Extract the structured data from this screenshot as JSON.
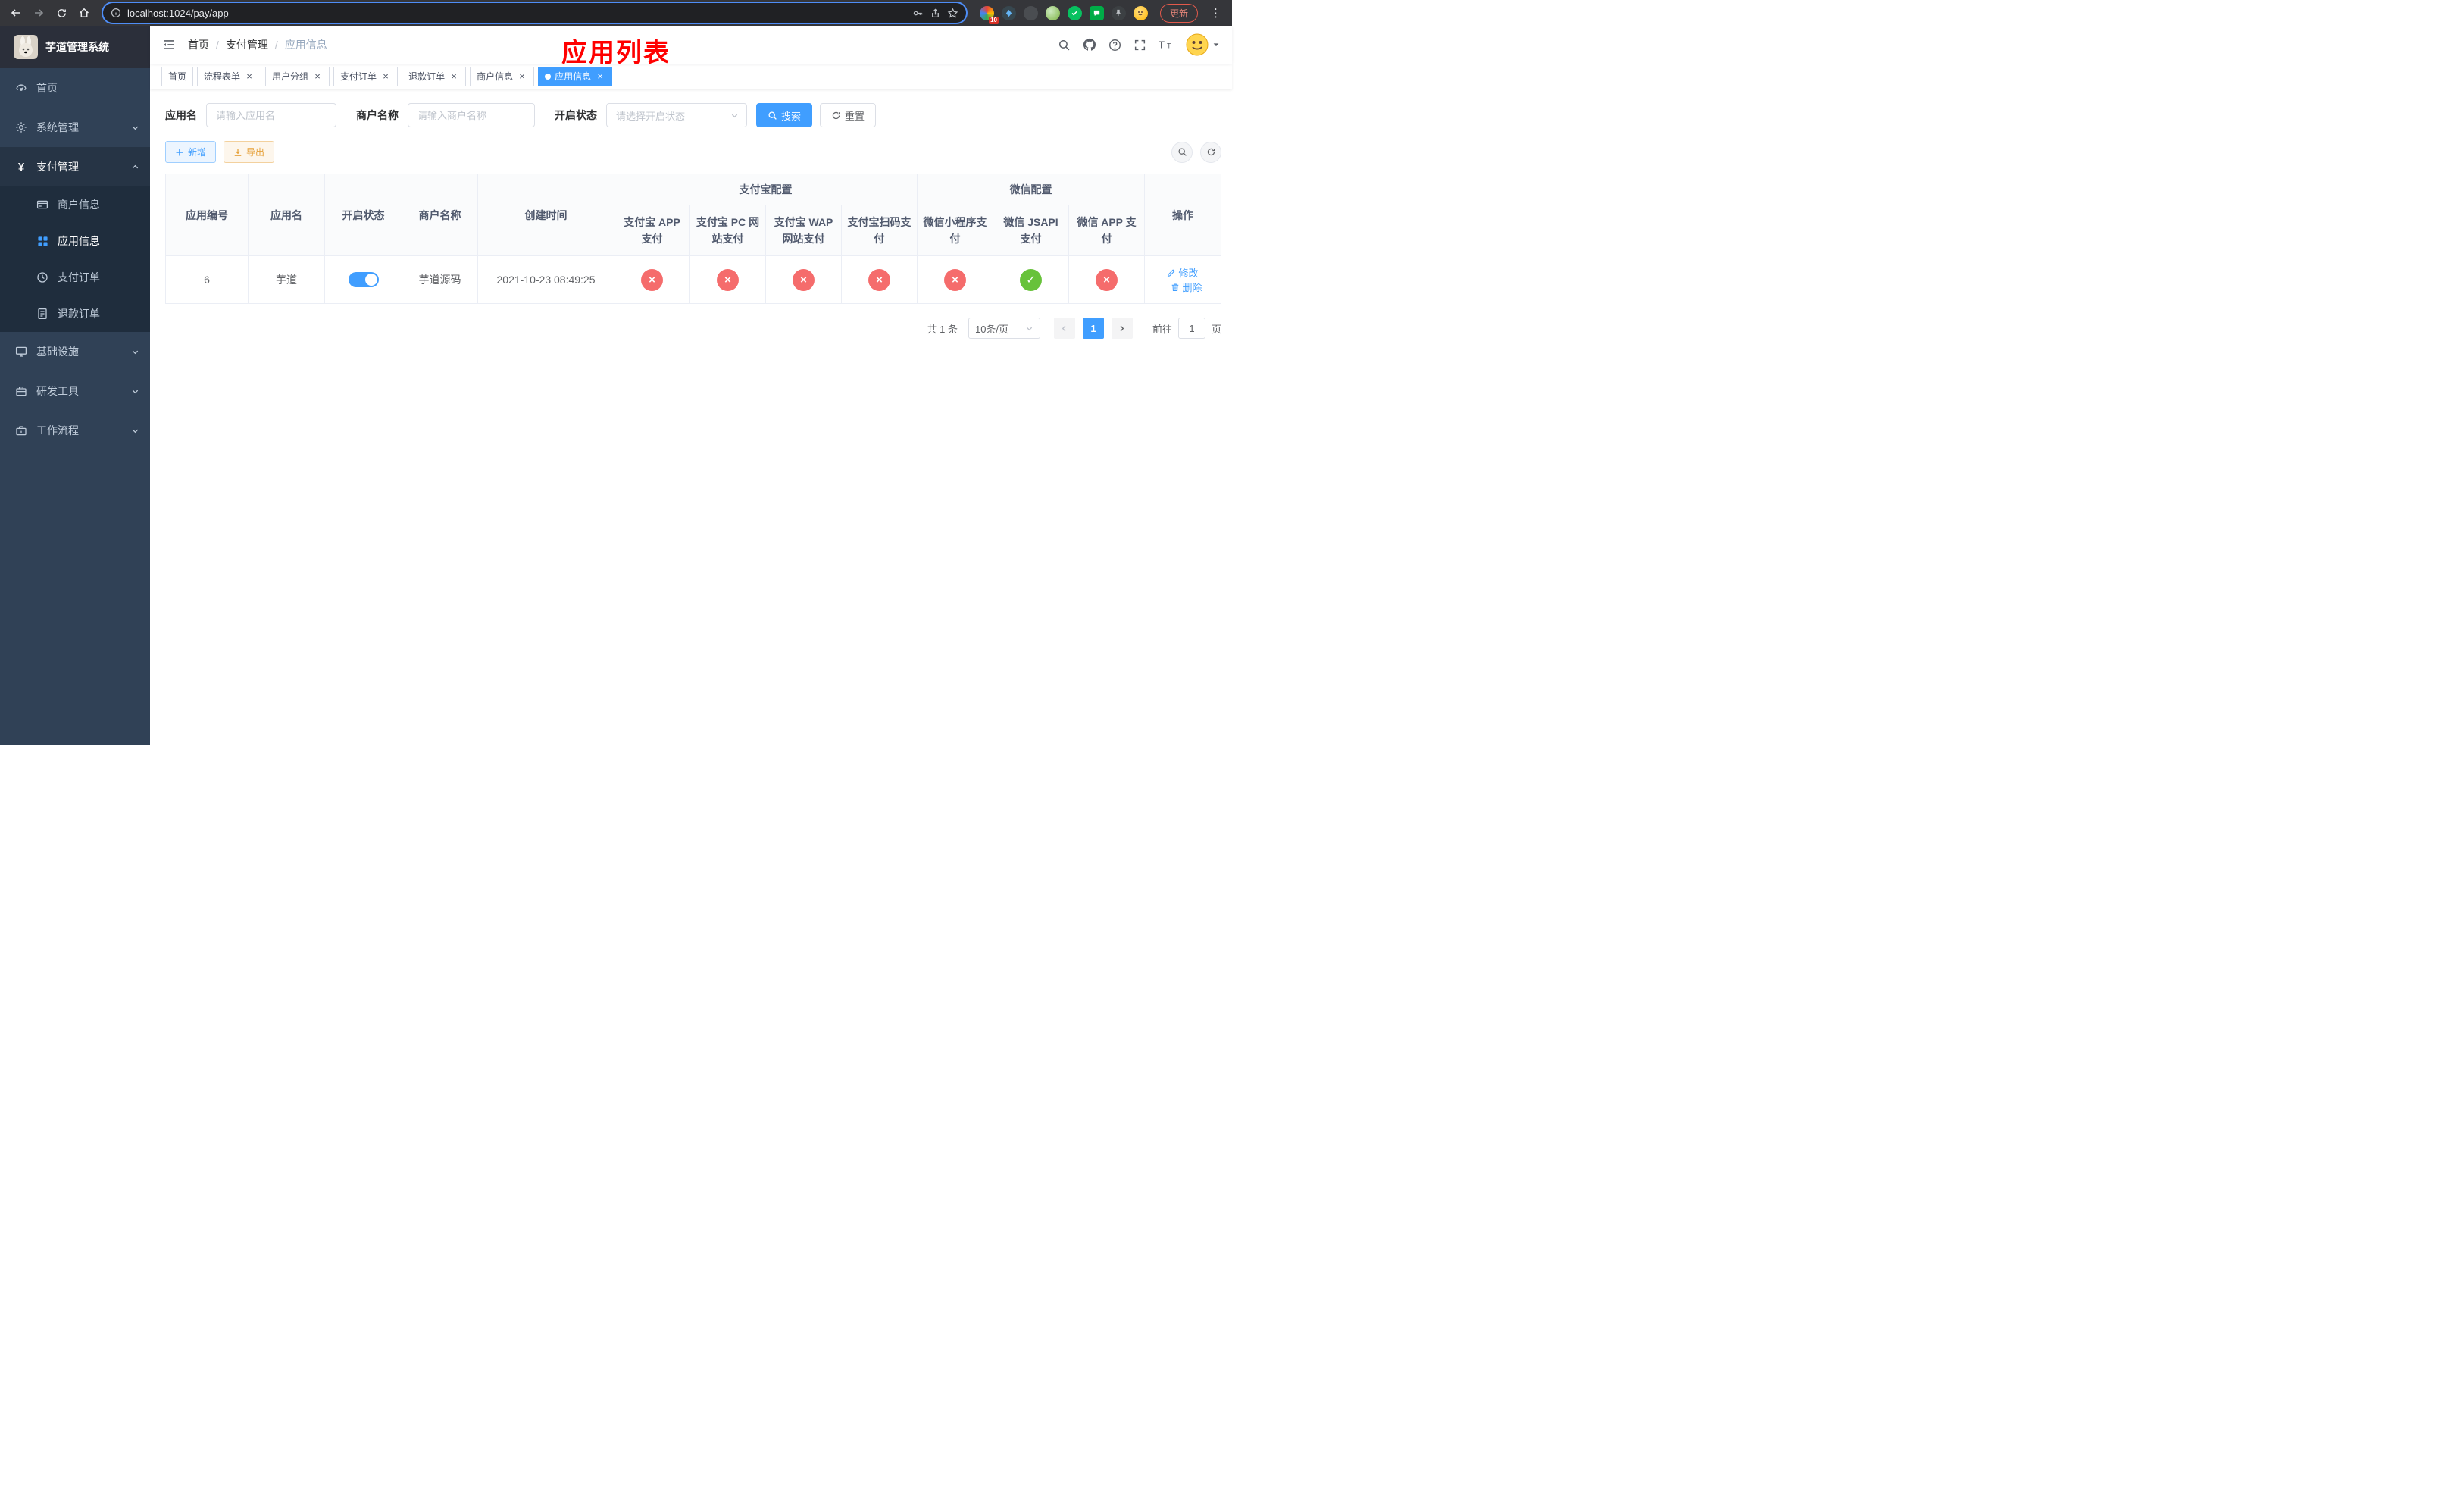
{
  "colors": {
    "accent": "#409eff",
    "danger": "#f56c6c",
    "success": "#67c23a",
    "warning": "#e6a23c",
    "annotation": "#ff0000",
    "sidebar_bg": "#304156",
    "submenu_bg": "#1f2d3d"
  },
  "browser": {
    "url": "localhost:1024/pay/app",
    "update_button": "更新",
    "extension_badge": "10"
  },
  "sidebar": {
    "title": "芋道管理系统",
    "menu": [
      {
        "label": "首页"
      },
      {
        "label": "系统管理"
      },
      {
        "label": "支付管理",
        "children": [
          {
            "label": "商户信息"
          },
          {
            "label": "应用信息"
          },
          {
            "label": "支付订单"
          },
          {
            "label": "退款订单"
          }
        ]
      },
      {
        "label": "基础设施"
      },
      {
        "label": "研发工具"
      },
      {
        "label": "工作流程"
      }
    ]
  },
  "header": {
    "breadcrumb": [
      "首页",
      "支付管理",
      "应用信息"
    ],
    "annotation_title": "应用列表"
  },
  "tabs": [
    {
      "label": "首页"
    },
    {
      "label": "流程表单"
    },
    {
      "label": "用户分组"
    },
    {
      "label": "支付订单"
    },
    {
      "label": "退款订单"
    },
    {
      "label": "商户信息"
    },
    {
      "label": "应用信息"
    }
  ],
  "filters": {
    "app_name": {
      "label": "应用名",
      "placeholder": "请输入应用名",
      "value": ""
    },
    "merchant_name": {
      "label": "商户名称",
      "placeholder": "请输入商户名称",
      "value": ""
    },
    "status": {
      "label": "开启状态",
      "placeholder": "请选择开启状态",
      "value": ""
    },
    "search": "搜索",
    "reset": "重置"
  },
  "toolbar": {
    "add": "新增",
    "export": "导出"
  },
  "table": {
    "headers": {
      "id": "应用编号",
      "name": "应用名",
      "status": "开启状态",
      "merchant": "商户名称",
      "created": "创建时间",
      "alipay_group": "支付宝配置",
      "wechat_group": "微信配置",
      "alipay_app": "支付宝 APP 支付",
      "alipay_pc": "支付宝 PC 网站支付",
      "alipay_wap": "支付宝 WAP 网站支付",
      "alipay_qr": "支付宝扫码支付",
      "wechat_lite": "微信小程序支付",
      "wechat_jsapi": "微信 JSAPI 支付",
      "wechat_app": "微信 APP 支付",
      "actions": "操作"
    },
    "row": {
      "id": "6",
      "name": "芋道",
      "enabled": true,
      "merchant": "芋道源码",
      "created": "2021-10-23 08:49:25",
      "statuses": [
        false,
        false,
        false,
        false,
        false,
        true,
        false
      ],
      "edit": "修改",
      "delete": "删除"
    }
  },
  "pagination": {
    "total": "共 1 条",
    "page_size": "10条/页",
    "current_page": "1",
    "goto_prefix": "前往",
    "goto_value": "1",
    "goto_suffix": "页"
  }
}
